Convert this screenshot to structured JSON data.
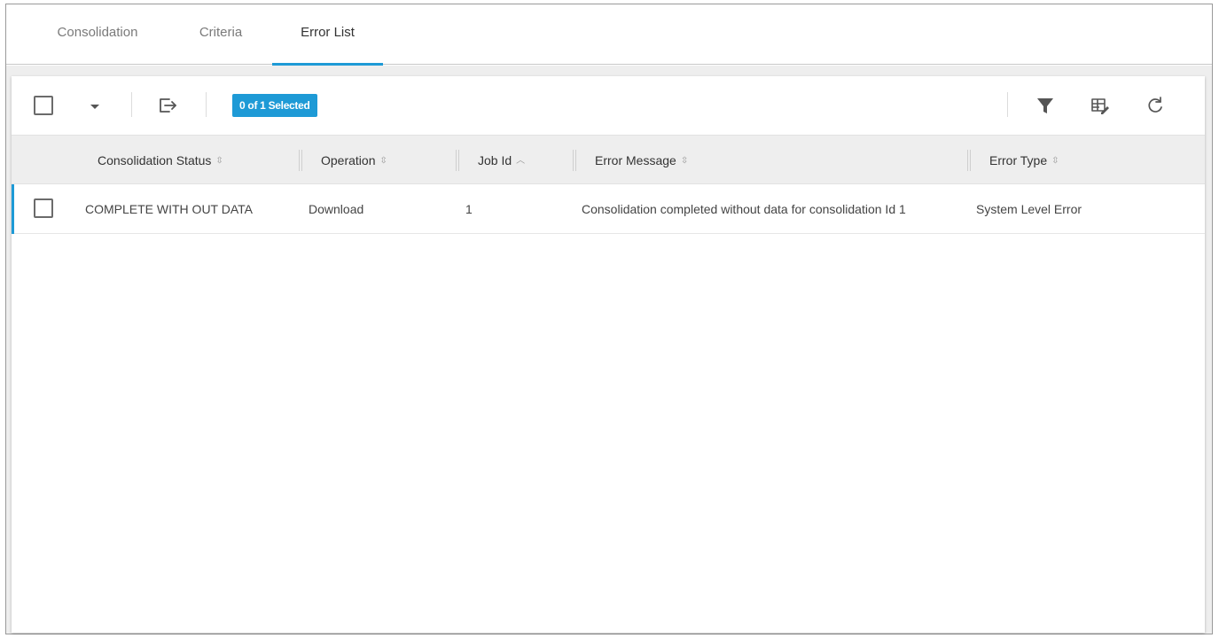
{
  "tabs": [
    {
      "label": "Consolidation",
      "active": false
    },
    {
      "label": "Criteria",
      "active": false
    },
    {
      "label": "Error List",
      "active": true
    }
  ],
  "toolbar": {
    "selection_badge": "0 of 1 Selected",
    "icons": {
      "select_all": "checkbox-icon",
      "dropdown": "caret-down-icon",
      "export": "export-icon",
      "filter": "filter-icon",
      "column_edit": "column-edit-icon",
      "refresh": "refresh-icon"
    }
  },
  "grid": {
    "columns": [
      {
        "label": "Consolidation Status",
        "sort": "none"
      },
      {
        "label": "Operation",
        "sort": "none"
      },
      {
        "label": "Job Id",
        "sort": "ascending"
      },
      {
        "label": "Error Message",
        "sort": "none"
      },
      {
        "label": "Error Type",
        "sort": "none"
      }
    ],
    "rows": [
      {
        "consolidation_status": "COMPLETE WITH OUT DATA",
        "operation": "Download",
        "job_id": "1",
        "error_message": "Consolidation completed without data for consolidation Id 1",
        "error_type": "System Level Error"
      }
    ]
  },
  "colors": {
    "accent": "#1e9ad6",
    "header_bg": "#eeeeee",
    "tab_inactive": "#7a7a7a"
  }
}
